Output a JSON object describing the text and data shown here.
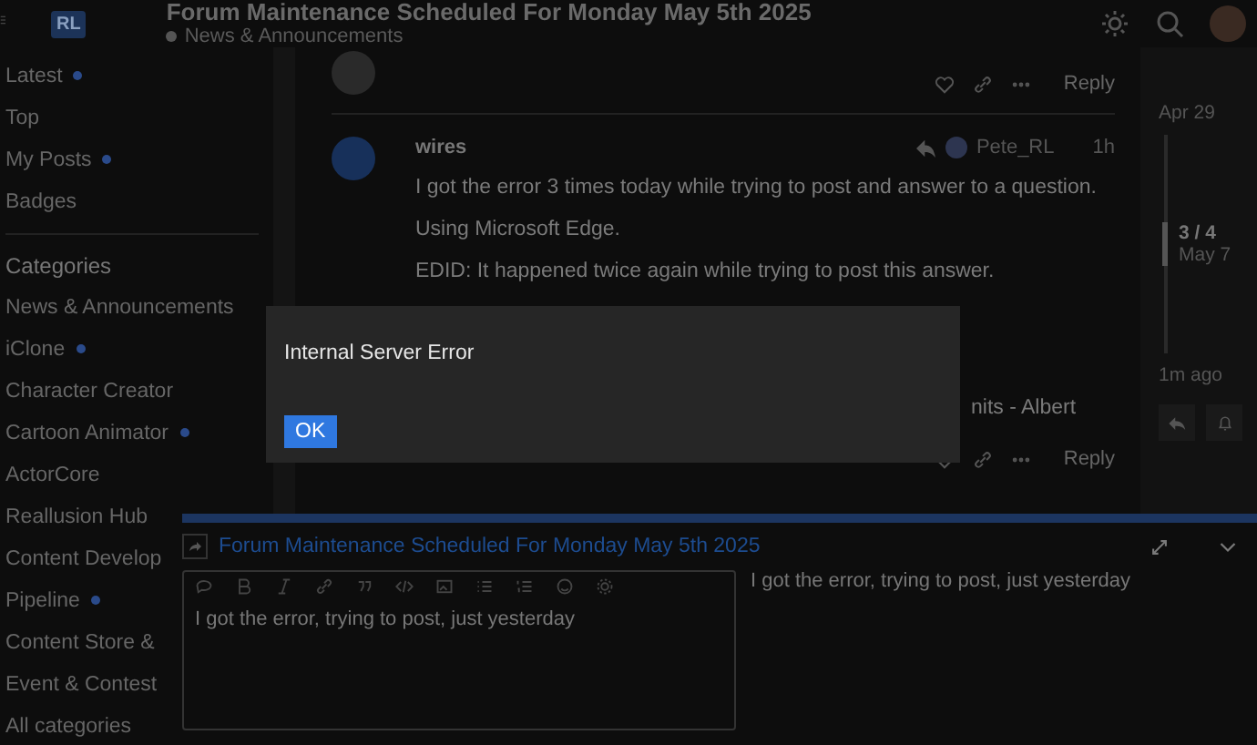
{
  "header": {
    "logo": "RL",
    "title": "Forum Maintenance Scheduled For Monday May 5th 2025",
    "category": "News & Announcements"
  },
  "sidebar": {
    "items": [
      {
        "label": "Latest",
        "unread": true
      },
      {
        "label": "Top",
        "unread": false
      },
      {
        "label": "My Posts",
        "unread": true
      },
      {
        "label": "Badges",
        "unread": false
      }
    ],
    "categories_heading": "Categories",
    "categories": [
      {
        "label": "News & Announcements",
        "unread": false
      },
      {
        "label": "iClone",
        "unread": true
      },
      {
        "label": "Character Creator",
        "unread": false
      },
      {
        "label": "Cartoon Animator",
        "unread": true
      },
      {
        "label": "ActorCore",
        "unread": false
      },
      {
        "label": "Reallusion Hub",
        "unread": false
      },
      {
        "label": "Content Develop",
        "unread": false
      },
      {
        "label": "Pipeline",
        "unread": true
      },
      {
        "label": "Content Store &",
        "unread": false
      },
      {
        "label": "Event & Contest",
        "unread": false
      },
      {
        "label": "All categories",
        "unread": false
      }
    ]
  },
  "posts": [
    {
      "reply_label": "Reply"
    },
    {
      "username": "wires",
      "reply_to": "Pete_RL",
      "time": "1h",
      "paragraphs": [
        "I got the error 3 times today while trying to post and answer to a question.",
        "Using Microsoft Edge.",
        "EDID: It happened twice again while trying to post this answer."
      ],
      "signature": "nits - Albert",
      "reply_label": "Reply"
    }
  ],
  "timeline": {
    "start": "Apr 29",
    "position": "3 / 4",
    "position_date": "May 7",
    "end": "1m ago"
  },
  "dialog": {
    "message": "Internal Server Error",
    "button": "OK"
  },
  "composer": {
    "topic": "Forum Maintenance Scheduled For Monday May 5th 2025",
    "text": "I got the error, trying to post, just yesterday",
    "preview": "I got the error, trying to post, just yesterday"
  }
}
